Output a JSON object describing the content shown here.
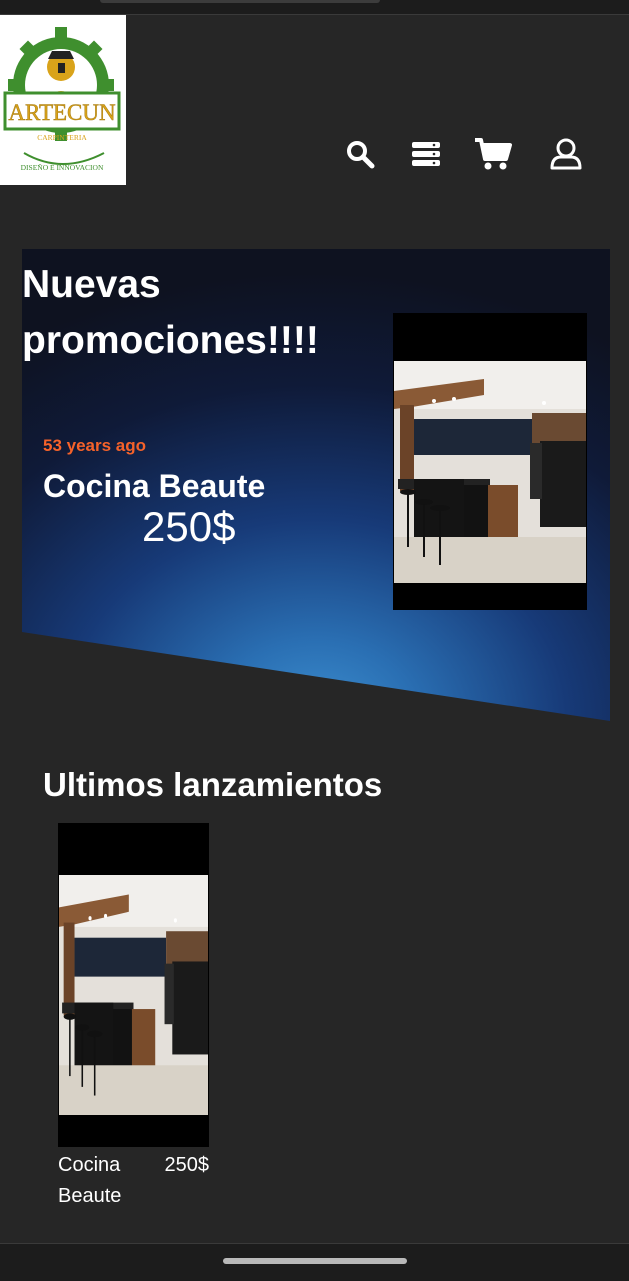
{
  "brand": {
    "name": "ARTECUN",
    "subtitle": "CARPINTERIA",
    "tagline": "DISEÑO E INNOVACION"
  },
  "header": {
    "icons": [
      "search-icon",
      "menu-icon",
      "cart-icon",
      "user-icon"
    ]
  },
  "hero": {
    "title": "Nuevas promociones!!!!",
    "time_ago": "53 years ago",
    "product_name": "Cocina Beaute",
    "price": "250$"
  },
  "latest": {
    "title": "Ultimos lanzamientos",
    "items": [
      {
        "name": "Cocina Beaute",
        "price": "250$"
      }
    ]
  },
  "colors": {
    "background": "#262626",
    "accent": "#f5622a",
    "hero_gradient_center": "#2a78b8",
    "hero_gradient_edge": "#0e1220",
    "logo_green": "#3f8f2e",
    "logo_gold": "#d9a31a"
  }
}
